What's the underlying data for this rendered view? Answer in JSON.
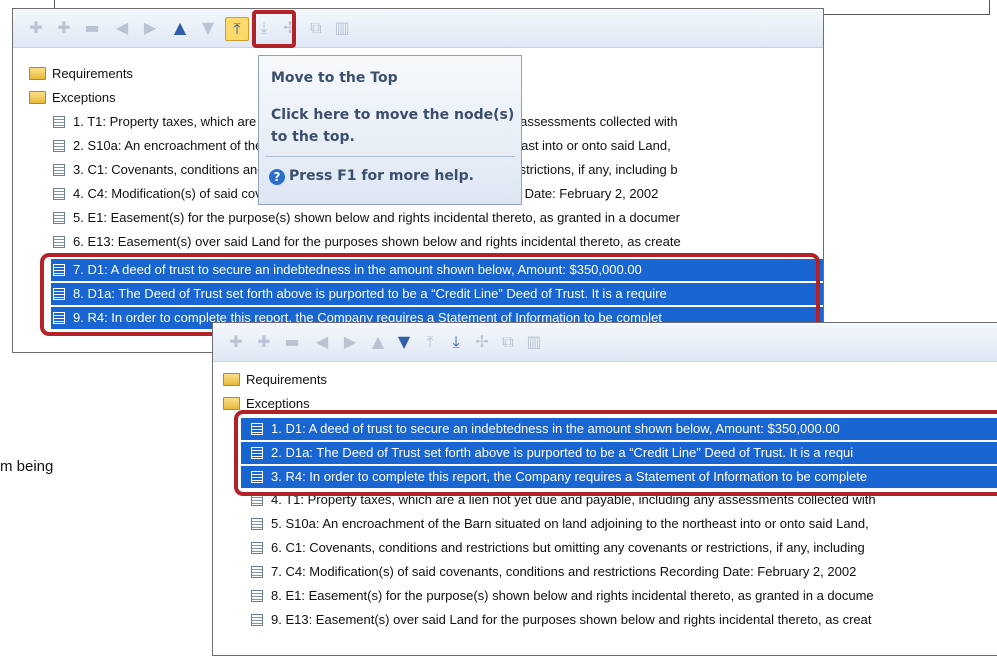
{
  "toolbar_top_icons": [
    "plus-icon",
    "add-child-icon",
    "minus-icon",
    "left-arrow-icon",
    "right-arrow-icon",
    "up-arrow-icon",
    "down-arrow-icon",
    "move-top-icon",
    "move-bottom-icon",
    "sort-icon",
    "copy-icon",
    "columns-icon"
  ],
  "tooltip": {
    "title": "Move to the Top",
    "body": "Click here to move the node(s) to the top.",
    "help": "Press F1 for more help."
  },
  "panel1": {
    "folders": [
      "Requirements",
      "Exceptions"
    ],
    "items": [
      "1. T1: Property taxes, which are a lien not yet due and payable, including any assessments collected with",
      "2. S10a: An encroachment of the Barn situated on land adjoining to the northeast into or onto said Land,",
      "3. C1: Covenants, conditions and restrictions but omitting any covenants or restrictions, if any, including b",
      "4. C4: Modification(s) of said covenants, conditions and restrictions   Recording Date: February 2, 2002",
      "5. E1: Easement(s) for the purpose(s) shown below and rights incidental thereto, as granted in a documer",
      "6. E13: Easement(s) over said Land for the purposes shown below and rights incidental thereto, as create",
      "7. D1: A deed of trust to secure an indebtedness in the amount shown below,     Amount:  $350,000.00",
      "8. D1a: The Deed of Trust set forth above is purported to be a “Credit Line” Deed of Trust.  It is a require",
      "9. R4: In order to complete this report, the Company requires a Statement of Information to be complet"
    ]
  },
  "panel2": {
    "folders": [
      "Requirements",
      "Exceptions"
    ],
    "items": [
      "1. D1: A deed of trust to secure an indebtedness in the amount shown below,     Amount:  $350,000.00",
      "2. D1a: The Deed of Trust set forth above is purported to be a “Credit Line” Deed of Trust.  It is a requi",
      "3. R4: In order to complete this report, the Company requires a Statement of Information to be complete",
      "4. T1: Property taxes, which are a lien not yet due and payable, including any assessments collected with",
      "5. S10a: An encroachment of the Barn situated on land adjoining to the northeast into or onto said Land,",
      "6. C1: Covenants, conditions and restrictions but omitting any covenants or restrictions, if any, including",
      "7. C4: Modification(s) of said covenants, conditions and restrictions   Recording Date:  February 2, 2002",
      "8. E1: Easement(s) for the purpose(s) shown below and rights incidental thereto, as granted in a docume",
      "9. E13: Easement(s) over said Land for the purposes shown below and rights incidental thereto, as creat"
    ]
  },
  "background_text": "m being"
}
